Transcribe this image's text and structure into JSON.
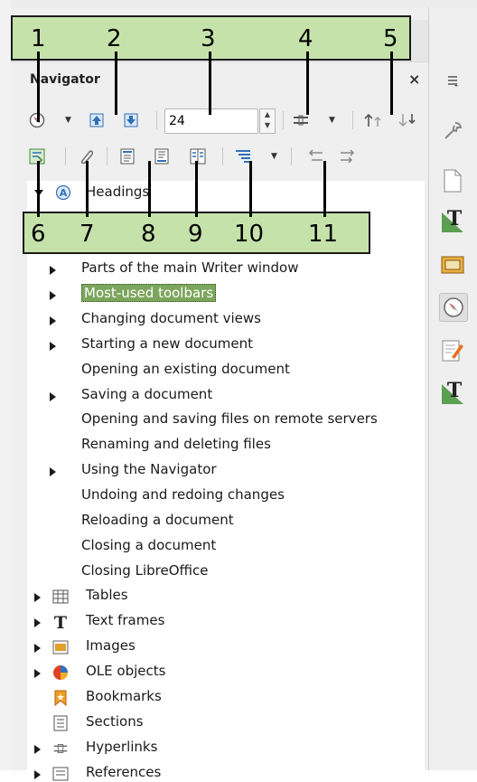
{
  "panel": {
    "title": "Navigator",
    "close_glyph": "×",
    "heading_level_value": "24"
  },
  "callout_numbers": [
    "1",
    "2",
    "3",
    "4",
    "5",
    "6",
    "7",
    "8",
    "9",
    "10",
    "11"
  ],
  "tree": {
    "headings_label": "Headings",
    "headings": [
      {
        "label": "Parts of the main Writer window",
        "expandable": true
      },
      {
        "label": "Most-used toolbars",
        "expandable": true,
        "selected": true
      },
      {
        "label": "Changing document views",
        "expandable": true
      },
      {
        "label": "Starting a new document",
        "expandable": true
      },
      {
        "label": "Opening an existing document",
        "expandable": false
      },
      {
        "label": "Saving a document",
        "expandable": true
      },
      {
        "label": "Opening and saving files on remote servers",
        "expandable": false
      },
      {
        "label": "Renaming and deleting files",
        "expandable": false
      },
      {
        "label": "Using the Navigator",
        "expandable": true
      },
      {
        "label": "Undoing and redoing changes",
        "expandable": false
      },
      {
        "label": "Reloading a document",
        "expandable": false
      },
      {
        "label": "Closing a document",
        "expandable": false
      },
      {
        "label": "Closing LibreOffice",
        "expandable": false
      }
    ],
    "categories": [
      {
        "label": "Tables",
        "icon": "table-icon",
        "expandable": true
      },
      {
        "label": "Text frames",
        "icon": "text-frame-icon",
        "expandable": true
      },
      {
        "label": "Images",
        "icon": "image-icon",
        "expandable": true
      },
      {
        "label": "OLE objects",
        "icon": "ole-object-icon",
        "expandable": true
      },
      {
        "label": "Bookmarks",
        "icon": "bookmark-icon",
        "expandable": false
      },
      {
        "label": "Sections",
        "icon": "section-icon",
        "expandable": false
      },
      {
        "label": "Hyperlinks",
        "icon": "hyperlink-icon",
        "expandable": true
      },
      {
        "label": "References",
        "icon": "reference-icon",
        "expandable": true
      }
    ]
  },
  "colors": {
    "callout_fill": "#c6e2ab",
    "selection": "#7ca65c"
  }
}
